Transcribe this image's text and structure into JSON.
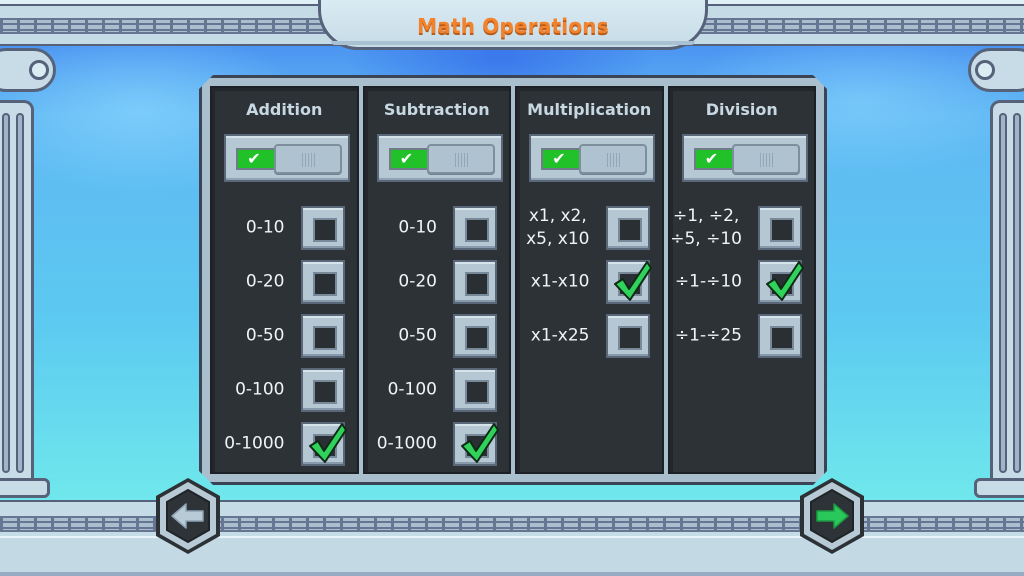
{
  "title": "Math Operations",
  "columns": [
    {
      "name": "Addition",
      "enabled": true,
      "options": [
        {
          "label": "0-10",
          "checked": false
        },
        {
          "label": "0-20",
          "checked": false
        },
        {
          "label": "0-50",
          "checked": false
        },
        {
          "label": "0-100",
          "checked": false
        },
        {
          "label": "0-1000",
          "checked": true
        }
      ]
    },
    {
      "name": "Subtraction",
      "enabled": true,
      "options": [
        {
          "label": "0-10",
          "checked": false
        },
        {
          "label": "0-20",
          "checked": false
        },
        {
          "label": "0-50",
          "checked": false
        },
        {
          "label": "0-100",
          "checked": false
        },
        {
          "label": "0-1000",
          "checked": true
        }
      ]
    },
    {
      "name": "Multiplication",
      "enabled": true,
      "options": [
        {
          "label": "x1, x2,\nx5, x10",
          "checked": false
        },
        {
          "label": "x1-x10",
          "checked": true
        },
        {
          "label": "x1-x25",
          "checked": false
        }
      ]
    },
    {
      "name": "Division",
      "enabled": true,
      "options": [
        {
          "label": "÷1, ÷2,\n÷5, ÷10",
          "checked": false
        },
        {
          "label": "÷1-÷10",
          "checked": true
        },
        {
          "label": "÷1-÷25",
          "checked": false
        }
      ]
    }
  ],
  "toggle_check_glyph": "✔",
  "navigation": {
    "prev_icon": "arrow-left-icon",
    "next_icon": "arrow-right-icon"
  },
  "colors": {
    "title": "#f2832e",
    "toggle_on": "#21c12a",
    "check_green": "#2fd35a",
    "next_arrow": "#28c85a",
    "prev_arrow": "#b7cad6",
    "panel_dark": "#2d3237"
  }
}
